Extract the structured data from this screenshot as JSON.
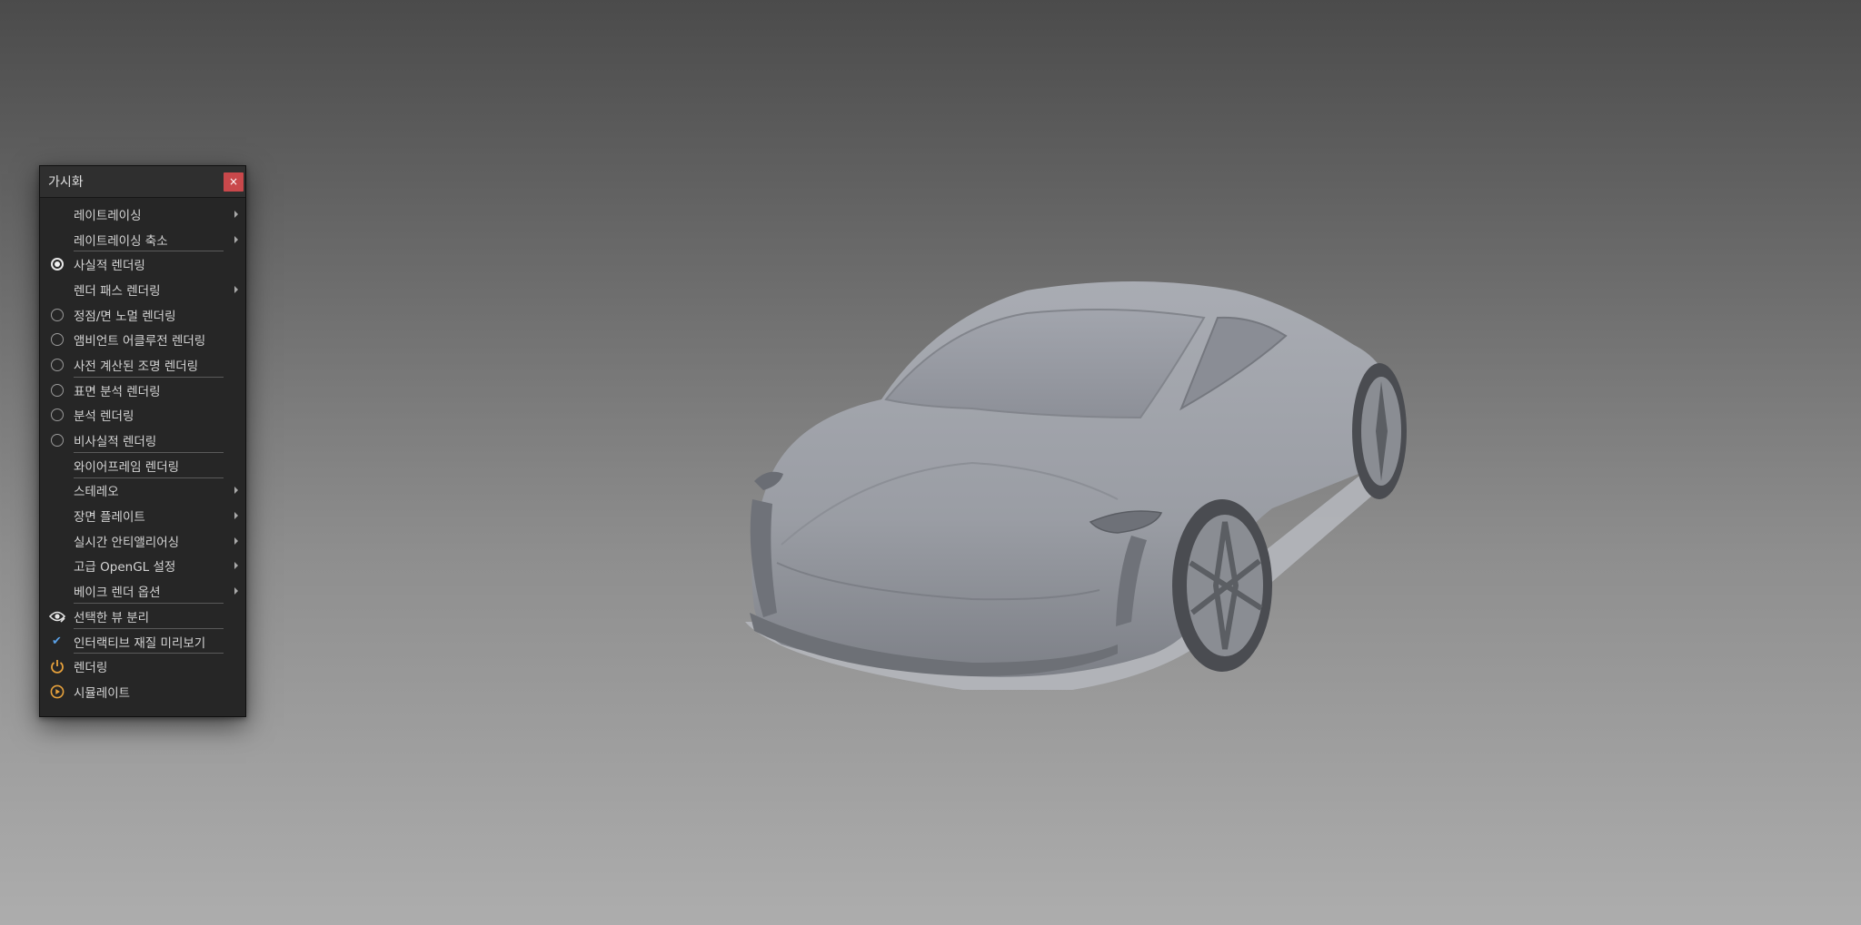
{
  "panel": {
    "title": "가시화",
    "close_label": "×",
    "items": [
      {
        "label": "레이트레이싱",
        "icon": "none",
        "submenu": true,
        "separator": false
      },
      {
        "label": "레이트레이싱 축소",
        "icon": "none",
        "submenu": true,
        "separator": true
      },
      {
        "label": "사실적 렌더링",
        "icon": "radio-selected",
        "submenu": false,
        "separator": false
      },
      {
        "label": "렌더 패스 렌더링",
        "icon": "none",
        "submenu": true,
        "separator": false
      },
      {
        "label": "정점/면 노멀 렌더링",
        "icon": "radio",
        "submenu": false,
        "separator": false
      },
      {
        "label": "앰비언트 어클루전 렌더링",
        "icon": "radio",
        "submenu": false,
        "separator": false
      },
      {
        "label": "사전 계산된 조명 렌더링",
        "icon": "radio",
        "submenu": false,
        "separator": true
      },
      {
        "label": "표면 분석 렌더링",
        "icon": "radio",
        "submenu": false,
        "separator": false
      },
      {
        "label": "분석 렌더링",
        "icon": "radio",
        "submenu": false,
        "separator": false
      },
      {
        "label": "비사실적 렌더링",
        "icon": "radio",
        "submenu": false,
        "separator": true
      },
      {
        "label": "와이어프레임 렌더링",
        "icon": "none",
        "submenu": false,
        "separator": true
      },
      {
        "label": "스테레오",
        "icon": "none",
        "submenu": true,
        "separator": false
      },
      {
        "label": "장면 플레이트",
        "icon": "none",
        "submenu": true,
        "separator": false
      },
      {
        "label": "실시간 안티앨리어싱",
        "icon": "none",
        "submenu": true,
        "separator": false
      },
      {
        "label": "고급 OpenGL 설정",
        "icon": "none",
        "submenu": true,
        "separator": false
      },
      {
        "label": "베이크 렌더 옵션",
        "icon": "none",
        "submenu": true,
        "separator": true
      },
      {
        "label": "선택한 뷰 분리",
        "icon": "eye-icon",
        "submenu": false,
        "separator": true
      },
      {
        "label": "인터랙티브 재질 미리보기",
        "icon": "check-icon",
        "submenu": false,
        "separator": true
      },
      {
        "label": "렌더링",
        "icon": "power-icon",
        "submenu": false,
        "separator": false
      },
      {
        "label": "시뮬레이트",
        "icon": "play-icon",
        "submenu": false,
        "separator": false
      }
    ]
  },
  "colors": {
    "panel_bg": "#262626",
    "close_button": "#c9484b",
    "accent_orange": "#e8a23c",
    "check_blue": "#5aa0e6"
  }
}
